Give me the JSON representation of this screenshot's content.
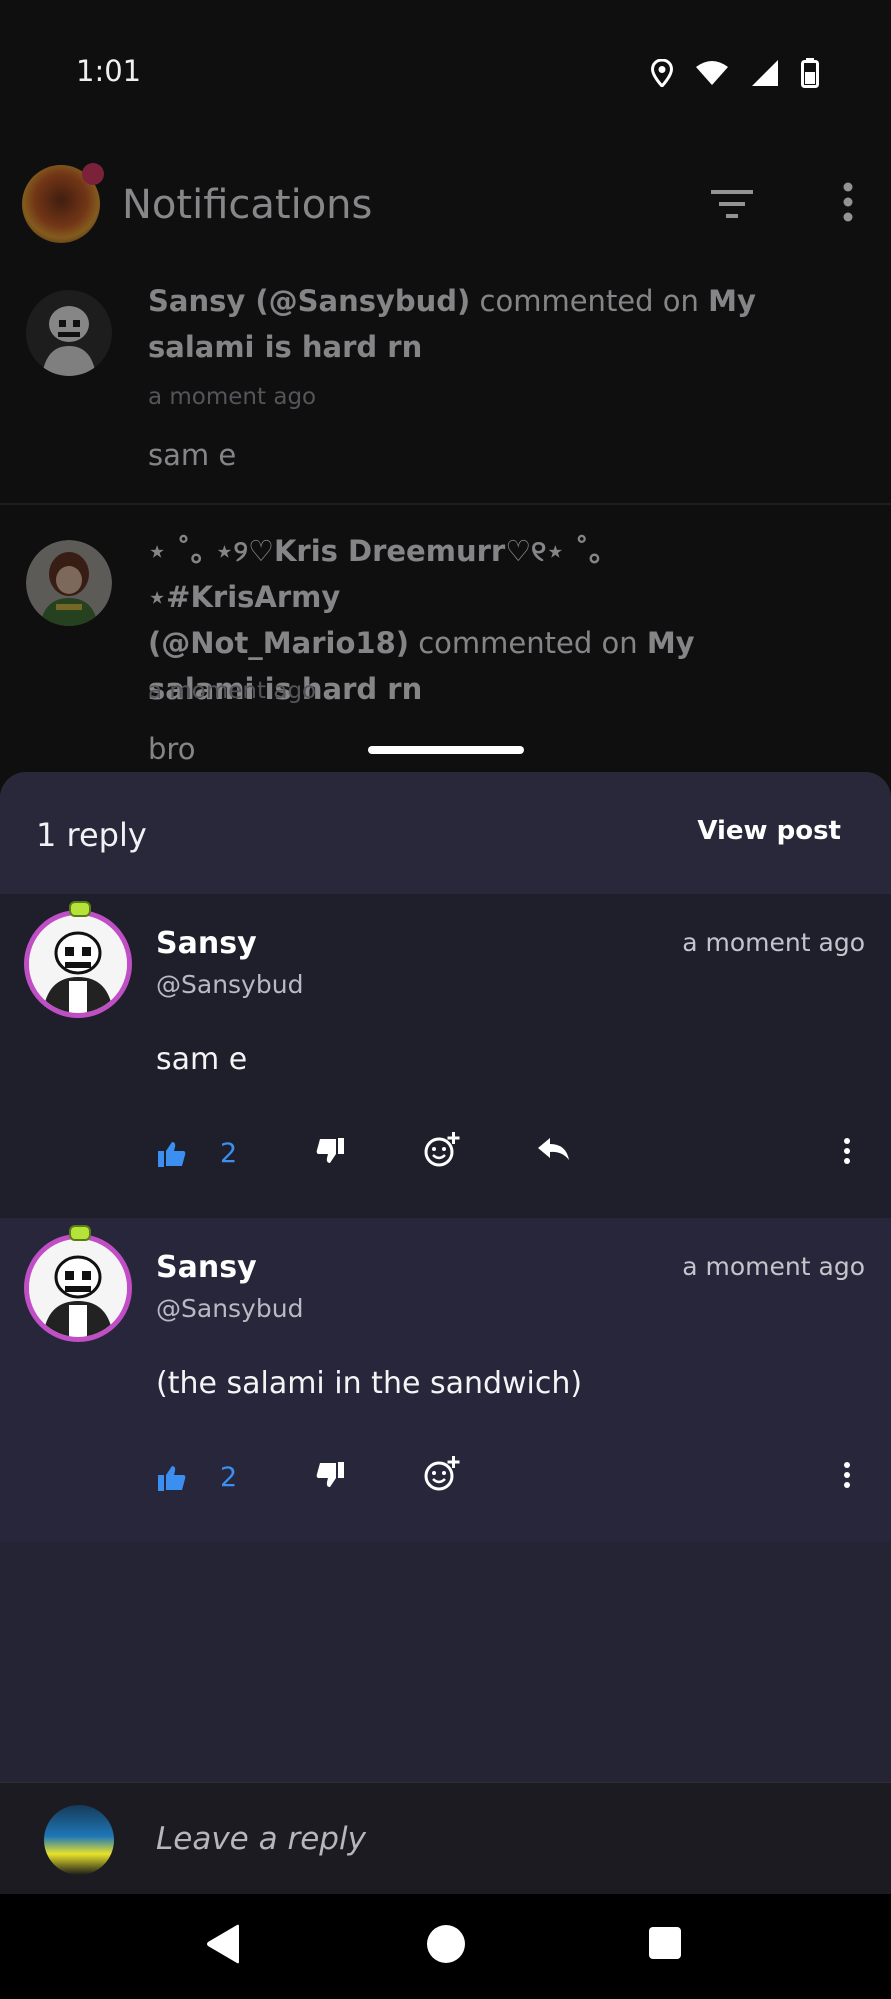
{
  "status_bar": {
    "time": "1:01"
  },
  "header": {
    "title": "Notifications"
  },
  "notifications": [
    {
      "actor": "Sansy (@Sansybud)",
      "action": "commented on",
      "post": "My salami is hard rn",
      "time": "a moment ago",
      "preview": "sam e"
    },
    {
      "actor_line": "⋆ ˚｡ ⋆୨♡Kris Dreemurr♡୧⋆ ˚｡ ⋆#KrisArmy",
      "actor_handle": "(@Not_Mario18)",
      "action": "commented on",
      "post_part1": "My",
      "post_part2": "salami is hard rn",
      "time": "a moment ago",
      "preview": "bro"
    }
  ],
  "sheet": {
    "reply_count": "1 reply",
    "view_post": "View post",
    "comments": [
      {
        "name": "Sansy",
        "handle": "@Sansybud",
        "time": "a moment ago",
        "body": "sam e",
        "likes": "2"
      },
      {
        "name": "Sansy",
        "handle": "@Sansybud",
        "time": "a moment ago",
        "body": "(the salami in the sandwich)",
        "likes": "2"
      }
    ],
    "reply_placeholder": "Leave a reply"
  },
  "colors": {
    "accent_like": "#3a8ff0",
    "sheet_bg": "#252434",
    "avatar_ring": "#c04fc5"
  }
}
